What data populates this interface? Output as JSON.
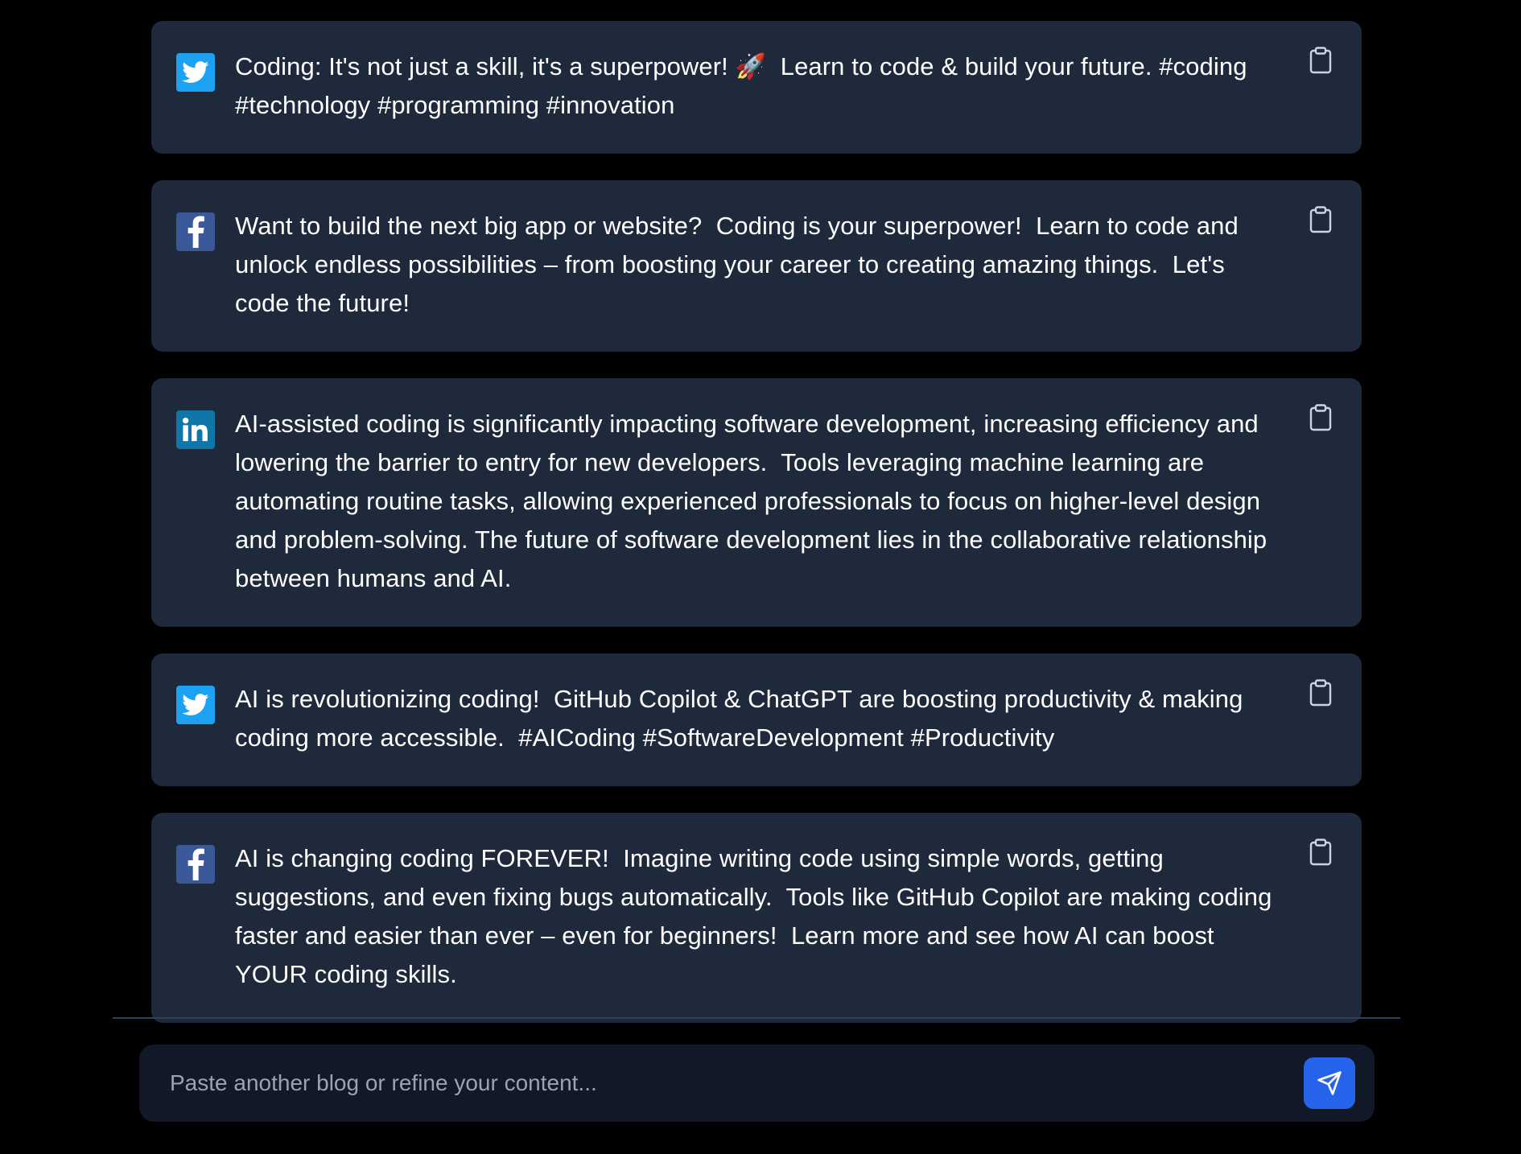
{
  "posts": [
    {
      "platform": "twitter",
      "icon": "twitter-icon",
      "text": "Coding: It's not just a skill, it's a superpower! 🚀  Learn to code & build your future. #coding #technology #programming #innovation"
    },
    {
      "platform": "facebook",
      "icon": "facebook-icon",
      "text": "Want to build the next big app or website?  Coding is your superpower!  Learn to code and unlock endless possibilities – from boosting your career to creating amazing things.  Let's code the future!"
    },
    {
      "platform": "linkedin",
      "icon": "linkedin-icon",
      "text": "AI-assisted coding is significantly impacting software development, increasing efficiency and lowering the barrier to entry for new developers.  Tools leveraging machine learning are automating routine tasks, allowing experienced professionals to focus on higher-level design and problem-solving. The future of software development lies in the collaborative relationship between humans and AI."
    },
    {
      "platform": "twitter",
      "icon": "twitter-icon",
      "text": "AI is revolutionizing coding!  GitHub Copilot & ChatGPT are boosting productivity & making coding more accessible.  #AICoding #SoftwareDevelopment #Productivity"
    },
    {
      "platform": "facebook",
      "icon": "facebook-icon",
      "text": "AI is changing coding FOREVER!  Imagine writing code using simple words, getting suggestions, and even fixing bugs automatically.  Tools like GitHub Copilot are making coding faster and easier than ever – even for beginners!  Learn more and see how AI can boost YOUR coding skills."
    }
  ],
  "composer": {
    "placeholder": "Paste another blog or refine your content...",
    "value": ""
  },
  "icons": {
    "copy": "clipboard-icon",
    "send": "send-icon"
  },
  "colors": {
    "background": "#000000",
    "card": "#1e293b",
    "composer": "#111827",
    "send_button": "#2563eb",
    "twitter": "#1da1f2",
    "facebook": "#3b5998",
    "linkedin": "#0e76a8",
    "text": "#ffffff",
    "muted": "#9ca3af"
  }
}
